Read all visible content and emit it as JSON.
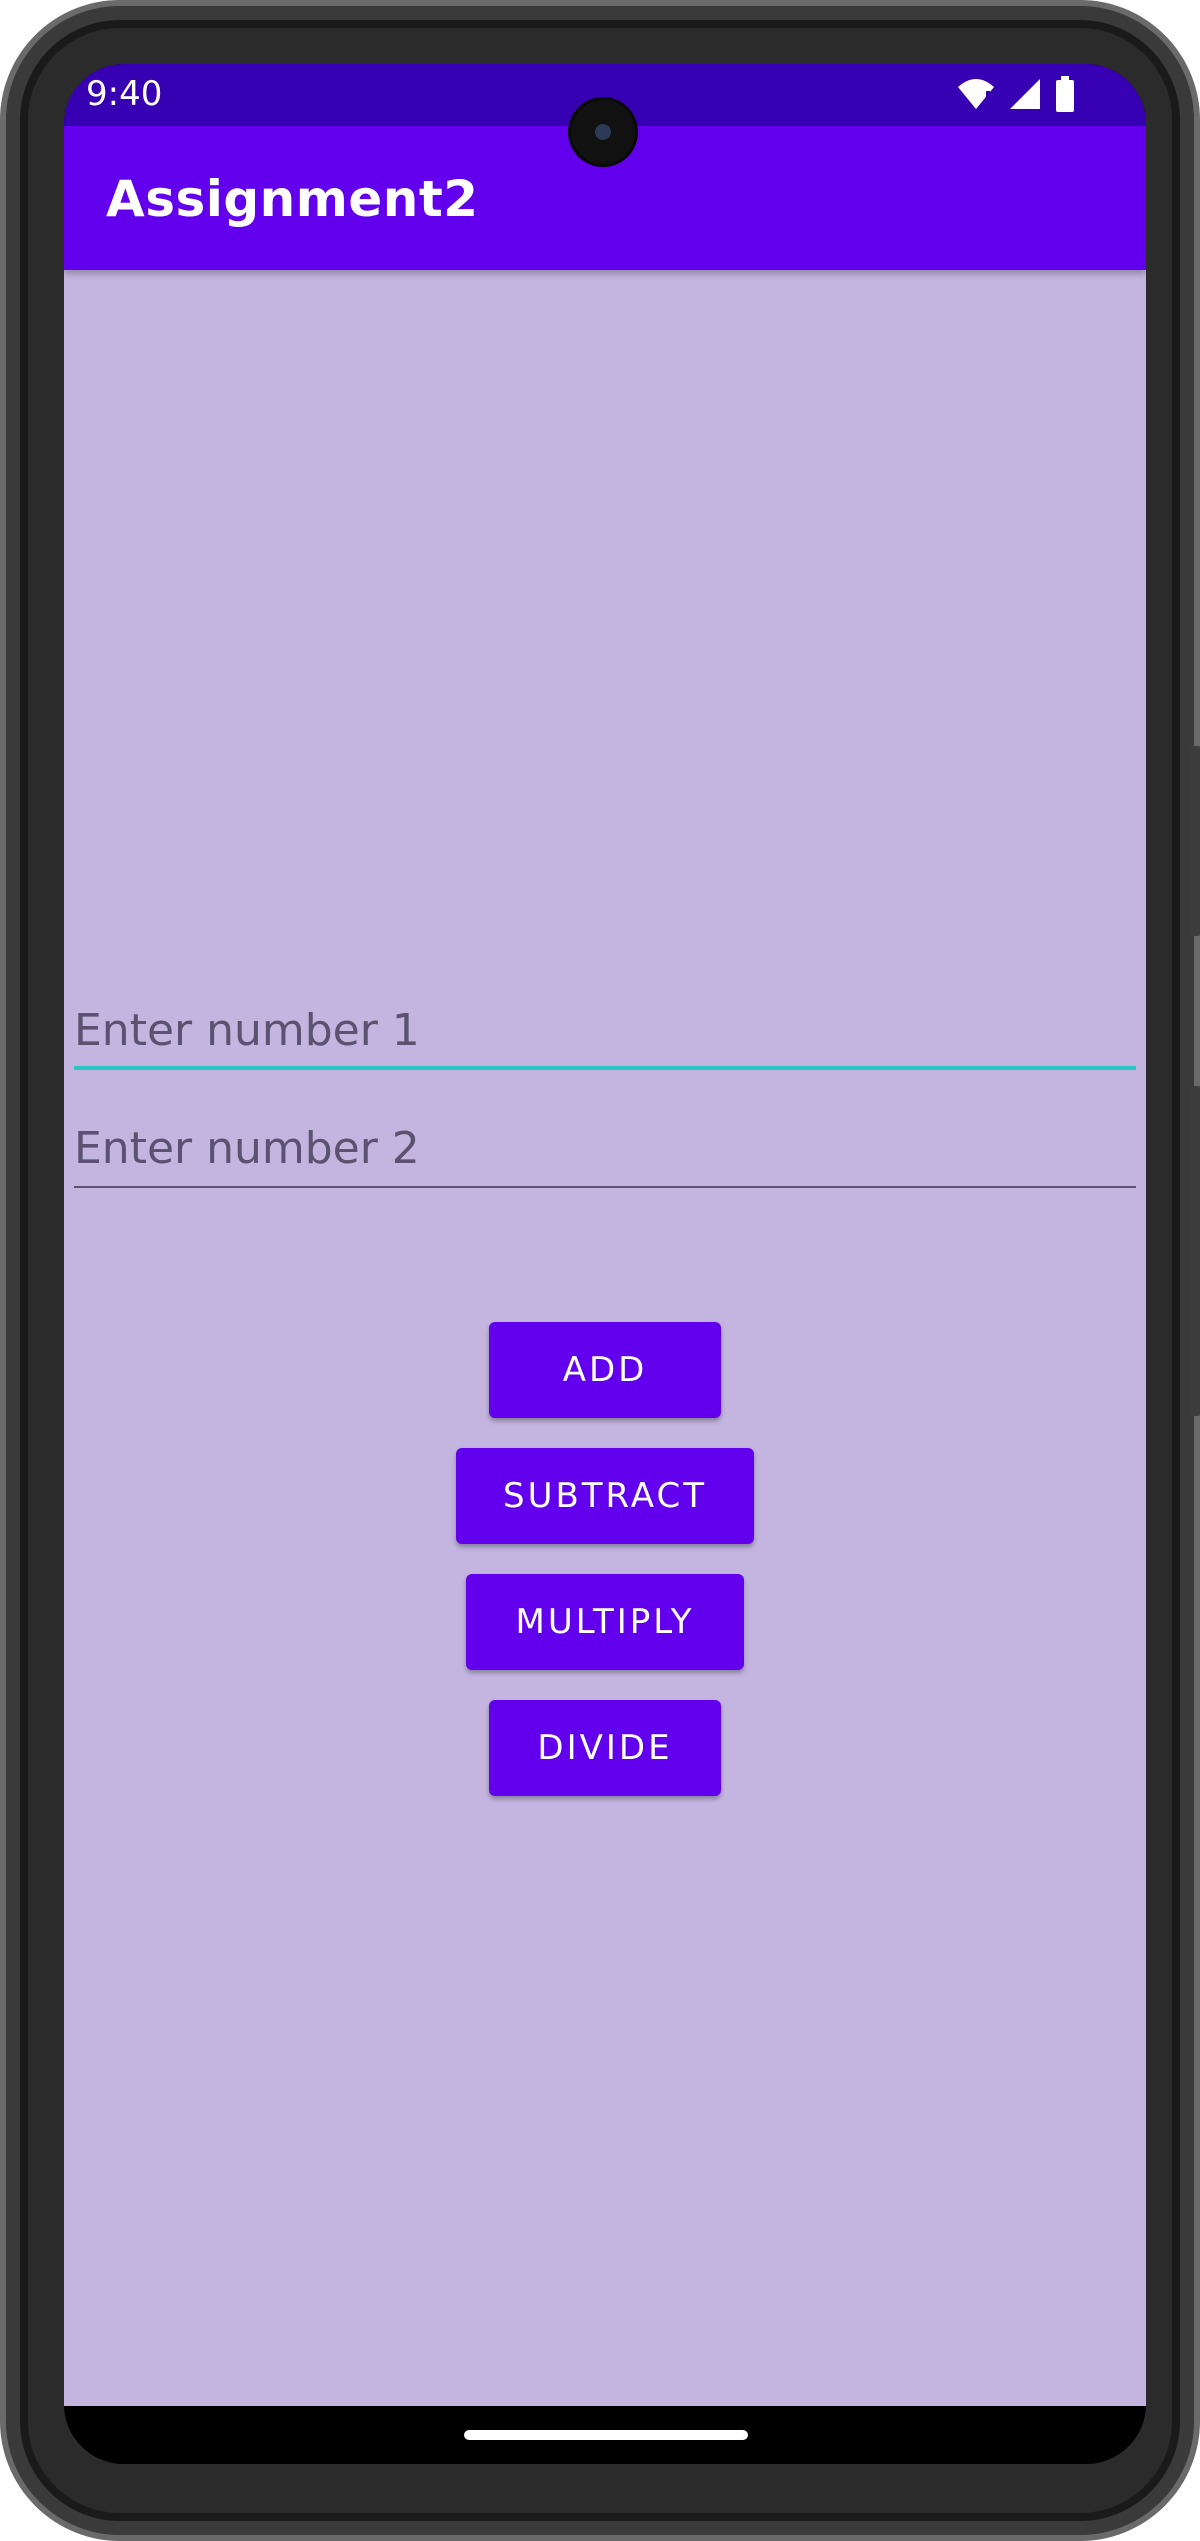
{
  "status_bar": {
    "time": "9:40",
    "icons": [
      "wifi-icon",
      "signal-icon",
      "battery-icon"
    ]
  },
  "app_bar": {
    "title": "Assignment2"
  },
  "form": {
    "number1_placeholder": "Enter number 1",
    "number2_placeholder": "Enter number 2"
  },
  "buttons": {
    "add": "ADD",
    "subtract": "SUBTRACT",
    "multiply": "MULTIPLY",
    "divide": "DIVIDE"
  },
  "colors": {
    "status_bar": "#3700b3",
    "primary": "#6200ee",
    "background": "#c3b5e0",
    "focus_accent": "#2ac8c4"
  }
}
